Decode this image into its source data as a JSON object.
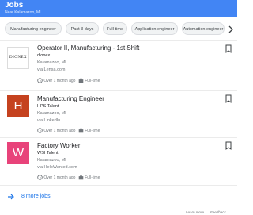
{
  "header": {
    "title": "Jobs",
    "subtitle": "Near Kalamazoo, MI",
    "background": "#4285f4"
  },
  "chips": [
    {
      "label": "Manufacturing engineer"
    },
    {
      "label": "Past 3 days"
    },
    {
      "label": "Full-time"
    },
    {
      "label": "Application engineer"
    },
    {
      "label": "Automation engineer"
    }
  ],
  "jobs": [
    {
      "title": "Operator II, Manufacturing - 1st Shift",
      "company": "dionex",
      "location": "Kalamazoo, MI",
      "via": "via Lensa.com",
      "posted": "Over 1 month ago",
      "type": "Full-time",
      "logo_text": "DIONEX",
      "logo_kind": "image"
    },
    {
      "title": "Manufacturing Engineer",
      "company": "HPS Talent",
      "location": "Kalamazoo, MI",
      "via": "via LinkedIn",
      "posted": "Over 1 month ago",
      "type": "Full-time",
      "logo_letter": "H",
      "logo_color": "#c5421f"
    },
    {
      "title": "Factory Worker",
      "company": "WSI Talent",
      "location": "Kalamazoo, MI",
      "via": "via HelpWanted.com",
      "posted": "Over 1 month ago",
      "type": "Full-time",
      "logo_letter": "W",
      "logo_color": "#e8437a"
    }
  ],
  "more_jobs": {
    "label": "8 more jobs"
  },
  "footer": {
    "learn_more": "Learn more",
    "feedback": "Feedback"
  },
  "colors": {
    "link": "#1a73e8",
    "text": "#202124",
    "muted": "#70757a",
    "divider": "#ebebeb"
  },
  "icons": {
    "chip_next": "chevron-right-icon",
    "bookmark": "bookmark-icon",
    "clock": "clock-icon",
    "briefcase": "briefcase-icon",
    "more": "arrow-right-icon"
  }
}
